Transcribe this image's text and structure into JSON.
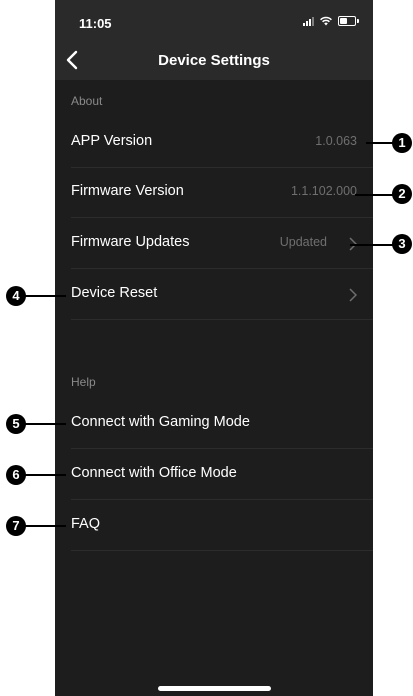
{
  "status_bar": {
    "time": "11:05"
  },
  "nav": {
    "title": "Device Settings"
  },
  "about": {
    "header": "About",
    "rows": [
      {
        "label": "APP Version",
        "value": "1.0.063"
      },
      {
        "label": "Firmware Version",
        "value": "1.1.102.000"
      },
      {
        "label": "Firmware Updates",
        "value": "Updated"
      },
      {
        "label": "Device Reset",
        "value": ""
      }
    ]
  },
  "help": {
    "header": "Help",
    "rows": [
      {
        "label": "Connect with Gaming Mode"
      },
      {
        "label": "Connect with Office Mode"
      },
      {
        "label": "FAQ"
      }
    ]
  },
  "callouts": [
    "1",
    "2",
    "3",
    "4",
    "5",
    "6",
    "7"
  ],
  "colors": {
    "background": "#1d1d1d",
    "bar": "#2a2a2a",
    "text": "#ffffff",
    "muted": "#6f6f6f",
    "callout": "#000000"
  },
  "icons": {
    "back": "chevron-left-icon",
    "disclosure": "chevron-right-icon"
  }
}
